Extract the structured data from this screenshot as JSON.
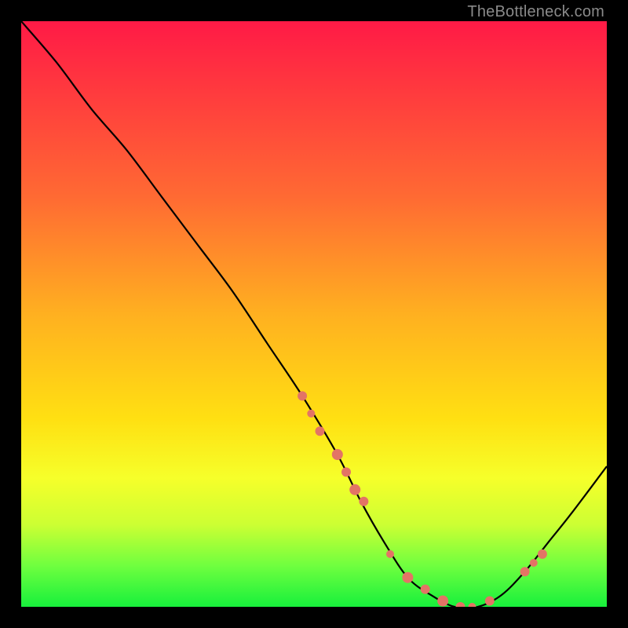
{
  "watermark": "TheBottleneck.com",
  "chart_data": {
    "type": "line",
    "title": "",
    "xlabel": "",
    "ylabel": "",
    "xlim": [
      0,
      100
    ],
    "ylim": [
      0,
      100
    ],
    "series": [
      {
        "name": "bottleneck-curve",
        "x": [
          0,
          6,
          12,
          18,
          24,
          30,
          36,
          42,
          48,
          54,
          58,
          62,
          66,
          70,
          74,
          78,
          82,
          86,
          90,
          94,
          100
        ],
        "y": [
          100,
          93,
          85,
          78,
          70,
          62,
          54,
          45,
          36,
          26,
          18,
          11,
          5,
          2,
          0,
          0,
          2,
          6,
          11,
          16,
          24
        ]
      }
    ],
    "markers": {
      "name": "highlight-points",
      "x": [
        48,
        49.5,
        51,
        54,
        55.5,
        57,
        58.5,
        63,
        66,
        69,
        72,
        75,
        77,
        80,
        86,
        87.5,
        89
      ],
      "y": [
        36,
        33,
        30,
        26,
        23,
        20,
        18,
        9,
        5,
        3,
        1,
        0,
        0,
        1,
        6,
        7.5,
        9
      ]
    },
    "gradient_stops": [
      {
        "pos": 0,
        "color": "#ff1a46"
      },
      {
        "pos": 30,
        "color": "#ff6a33"
      },
      {
        "pos": 68,
        "color": "#ffe012"
      },
      {
        "pos": 100,
        "color": "#17f03c"
      }
    ]
  }
}
